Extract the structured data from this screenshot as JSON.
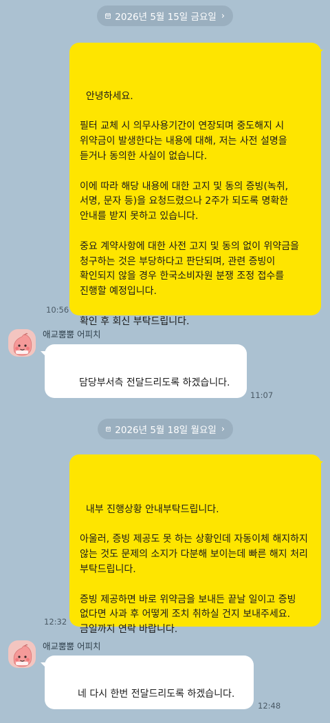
{
  "date_separators": [
    {
      "label": "2026년 5월 15일 금요일"
    },
    {
      "label": "2026년 5월 18일 월요일"
    }
  ],
  "messages": [
    {
      "side": "me",
      "text": "안녕하세요.\n\n필터 교체 시 의무사용기간이 연장되며 중도해지 시 위약금이 발생한다는 내용에 대해, 저는 사전 설명을 듣거나 동의한 사실이 없습니다.\n\n이에 따라 해당 내용에 대한 고지 및 동의 증빙(녹취, 서명, 문자 등)을 요청드렸으나 2주가 되도록 명확한 안내를 받지 못하고 있습니다.\n\n중요 계약사항에 대한 사전 고지 및 동의 없이 위약금을 청구하는 것은 부당하다고 판단되며, 관련 증빙이 확인되지 않을 경우 한국소비자원 분쟁 조정 접수를 진행할 예정입니다.\n\n확인 후 회신 부탁드립니다.",
      "time": "10:56"
    },
    {
      "side": "other",
      "sender": "애교뿜뿜 어피치",
      "text": "담당부서측 전달드리도록 하겠습니다.",
      "time": "11:07"
    },
    {
      "side": "me",
      "text": "내부 진행상황 안내부탁드립니다.\n\n아울러, 증빙 제공도 못 하는 상황인데 자동이체 해지하지 않는 것도 문제의 소지가 다분해 보이는데 빠른 해지 처리 부탁드립니다.\n\n증빙 제공하면 바로 위약금을 보내든 끝날 일이고 증빙 없다면 사과 후 어떻게 조치 취하실 건지 보내주세요. 금일까지 연락 바랍니다.",
      "time": "12:32"
    },
    {
      "side": "other",
      "sender": "애교뿜뿜 어피치",
      "text": "네 다시 한번 전달드리도록 하겠습니다.",
      "time": "12:48"
    }
  ],
  "icons": {
    "date_chip": "calendar-icon",
    "date_chip_arrow": "chevron-right-icon",
    "avatar": "apeach-avatar"
  },
  "colors": {
    "background": "#abc1d1",
    "my_bubble": "#fee500",
    "other_bubble": "#ffffff",
    "date_chip": "#9aafbf"
  }
}
